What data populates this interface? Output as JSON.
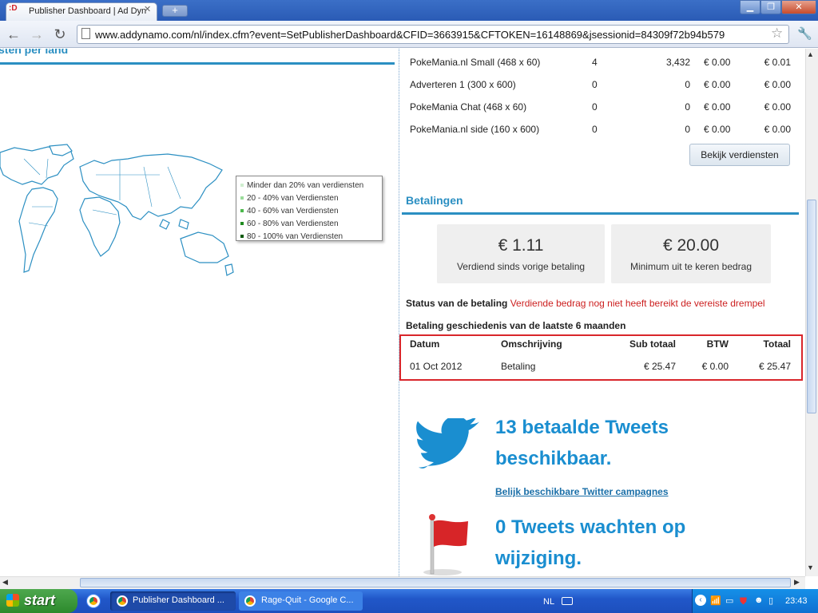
{
  "browser": {
    "tab_title": "Publisher Dashboard | Ad Dyn",
    "tab_favicon": ":D",
    "url": "www.addynamo.com/nl/index.cfm?event=SetPublisherDashboard&CFID=3663915&CFTOKEN=16148869&jsessionid=84309f72b94b579"
  },
  "left": {
    "section_title": "sten per land",
    "legend": [
      {
        "label": "Minder dan 20% van verdiensten",
        "color": "#cfeecf"
      },
      {
        "label": "20 - 40% van Verdiensten",
        "color": "#9bdc9b"
      },
      {
        "label": "40 - 60% van Verdiensten",
        "color": "#4cb84c"
      },
      {
        "label": "60 - 80% van Verdiensten",
        "color": "#1f8a1f"
      },
      {
        "label": "80 - 100% van Verdiensten",
        "color": "#0b5a0b"
      }
    ]
  },
  "ads": {
    "rows": [
      {
        "name": "PokeMania.nl Small (468 x 60)",
        "a": "4",
        "b": "3,432",
        "c": "€ 0.00",
        "d": "€ 0.01"
      },
      {
        "name": "Adverteren 1 (300 x 600)",
        "a": "0",
        "b": "0",
        "c": "€ 0.00",
        "d": "€ 0.00"
      },
      {
        "name": "PokeMania Chat (468 x 60)",
        "a": "0",
        "b": "0",
        "c": "€ 0.00",
        "d": "€ 0.00"
      },
      {
        "name": "PokeMania.nl side (160 x 600)",
        "a": "0",
        "b": "0",
        "c": "€ 0.00",
        "d": "€ 0.00"
      }
    ],
    "button": "Bekijk verdiensten"
  },
  "payments": {
    "title": "Betalingen",
    "card1_amount": "€ 1.11",
    "card1_label": "Verdiend sinds vorige betaling",
    "card2_amount": "€ 20.00",
    "card2_label": "Minimum uit te keren bedrag",
    "status_label": "Status van de betaling",
    "status_value": "Verdiende bedrag nog niet heeft bereikt de vereiste drempel",
    "history_title": "Betaling geschiedenis van de laatste 6 maanden",
    "headers": {
      "date": "Datum",
      "desc": "Omschrijving",
      "sub": "Sub totaal",
      "vat": "BTW",
      "total": "Totaal"
    },
    "row": {
      "date": "01 Oct 2012",
      "desc": "Betaling",
      "sub": "€ 25.47",
      "vat": "€ 0.00",
      "total": "€ 25.47"
    },
    "highlight_color": "#d9262b"
  },
  "twitter": {
    "paid_line1": "13 betaalde Tweets",
    "paid_line2": "beschikbaar.",
    "link": "Belijk beschikbare Twitter campagnes",
    "waiting_line1": "0 Tweets wachten op",
    "waiting_line2": "wijziging."
  },
  "taskbar": {
    "start": "start",
    "task1": "Publisher Dashboard ...",
    "task2": "Rage-Quit - Google C...",
    "lang": "NL",
    "clock": "23:43"
  }
}
